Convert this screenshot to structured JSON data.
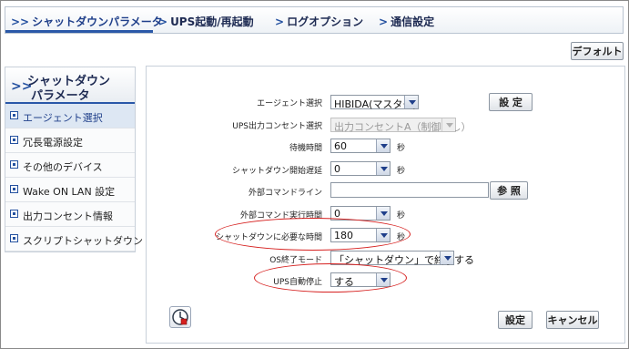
{
  "tabs": [
    {
      "label": "シャットダウンパラメータ"
    },
    {
      "label": "UPS起動/再起動"
    },
    {
      "label": "ログオプション"
    },
    {
      "label": "通信設定"
    }
  ],
  "default_button": "デフォルト",
  "sidebar": {
    "title_line1": "シャットダウン",
    "title_line2": "パラメータ",
    "items": [
      {
        "label": "エージェント選択"
      },
      {
        "label": "冗長電源設定"
      },
      {
        "label": "その他のデバイス"
      },
      {
        "label": "Wake ON LAN 設定"
      },
      {
        "label": "出力コンセント情報"
      },
      {
        "label": "スクリプトシャットダウン"
      }
    ]
  },
  "form": {
    "agent": {
      "label": "エージェント選択",
      "value": "HIBIDA(マスター)",
      "button": "設 定"
    },
    "ups_outlet": {
      "label": "UPS出力コンセント選択",
      "value": "出力コンセントA（制御なし）"
    },
    "wait_time": {
      "label": "待機時間",
      "value": "60",
      "unit": "秒"
    },
    "shutdown_delay": {
      "label": "シャットダウン開始遅延",
      "value": "0",
      "unit": "秒"
    },
    "ext_command": {
      "label": "外部コマンドライン",
      "value": "",
      "button": "参 照"
    },
    "ext_command_time": {
      "label": "外部コマンド実行時間",
      "value": "0",
      "unit": "秒"
    },
    "shutdown_required": {
      "label": "シャットダウンに必要な時間",
      "value": "180",
      "unit": "秒"
    },
    "os_mode": {
      "label": "OS終了モード",
      "value": "「シャットダウン」で終了する"
    },
    "ups_autostop": {
      "label": "UPS自動停止",
      "value": "する"
    }
  },
  "buttons": {
    "apply": "設定",
    "cancel": "キャンセル"
  },
  "colors": {
    "accent": "#2451a0",
    "highlight": "#d6201f",
    "active_bg": "#dde7f3"
  },
  "icons": {
    "tool": "ups-tool-icon"
  }
}
